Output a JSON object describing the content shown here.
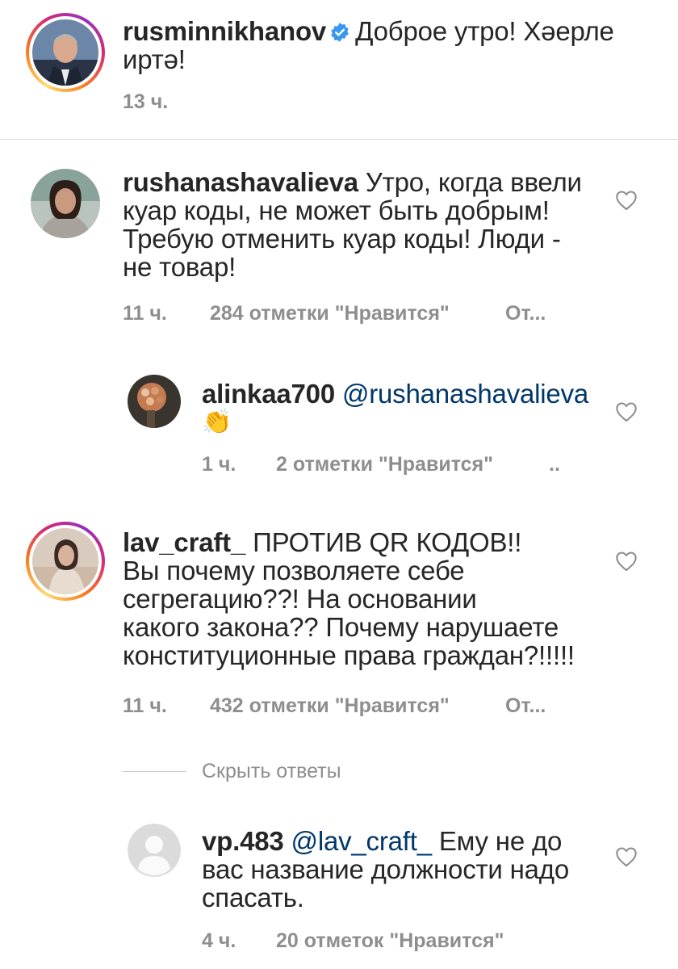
{
  "post": {
    "username": "rusminnikhanov",
    "text": "Доброе утро! Хәерле иртә!",
    "text_line1": "Доброе утро! Хәерле",
    "text_line2": "иртә!",
    "time": "13 ч."
  },
  "comments": [
    {
      "username": "rushanashavalieva",
      "line1": "Утро, когда ввели",
      "line2": "куар коды, не может быть добрым!",
      "line3": "Требую отменить куар коды! Люди -",
      "line4": "не товар!",
      "time": "11 ч.",
      "likes": "284 отметки \"Нравится\"",
      "reply": "От..."
    },
    {
      "username": "alinkaa700",
      "mention": "@rushanashavalieva",
      "emoji": "👏",
      "time": "1 ч.",
      "likes": "2 отметки \"Нравится\"",
      "reply": ".."
    },
    {
      "username": "lav_craft_",
      "line1": "ПРОТИВ QR КОДОВ!!",
      "line2": "Вы почему позволяете себе",
      "line3": "сегрегацию??! На основании",
      "line4": "какого закона?? Почему нарушаете",
      "line5": "конституционные права граждан?!!!!!",
      "time": "11 ч.",
      "likes": "432 отметки \"Нравится\"",
      "reply": "От..."
    },
    {
      "username": "vp.483",
      "mention": "@lav_craft_",
      "line1": "Ему не до",
      "line2": "вас название должности надо",
      "line3": "спасать.",
      "time": "4 ч.",
      "likes": "20 отметок \"Нравится\""
    }
  ],
  "hide_replies": "Скрыть ответы",
  "icons": {
    "verified": "verified-badge-icon",
    "like": "heart-outline-icon"
  },
  "colors": {
    "text": "#262626",
    "meta": "#8e8e8e",
    "mention": "#00376b",
    "verified": "#3897f0"
  }
}
